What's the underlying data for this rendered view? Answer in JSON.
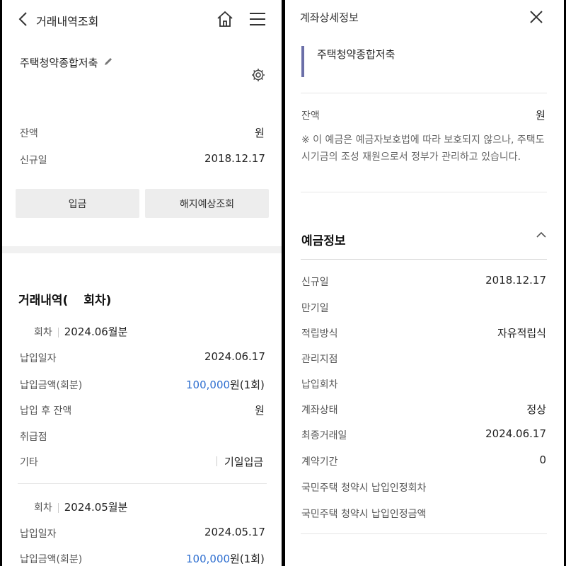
{
  "left": {
    "header": {
      "title": "거래내역조회"
    },
    "account": {
      "name": "주택청약종합저축"
    },
    "summary": {
      "balance_label": "잔액",
      "balance_unit": "원",
      "open_label": "신규일",
      "open_value": "2018.12.17"
    },
    "buttons": {
      "deposit": "입금",
      "termination": "해지예상조회"
    },
    "history": {
      "title_prefix": "거래내역(",
      "title_suffix": "회차)",
      "entries": [
        {
          "round_label": "회차",
          "round_value": "2024.06월분",
          "pay_date_label": "납입일자",
          "pay_date": "2024.06.17",
          "amount_label": "납입금액(회분)",
          "amount": "100,000",
          "amount_unit": "원(1회)",
          "after_label": "납입 후 잔액",
          "after_unit": "원",
          "branch_label": "취급점",
          "etc_label": "기타",
          "etc_value": "기일입금"
        },
        {
          "round_label": "회차",
          "round_value": "2024.05월분",
          "pay_date_label": "납입일자",
          "pay_date": "2024.05.17",
          "amount_label": "납입금액(회분)",
          "amount": "100,000",
          "amount_unit": "원(1회)"
        }
      ]
    }
  },
  "right": {
    "header": {
      "title": "계좌상세정보"
    },
    "account": {
      "name": "주택청약종합저축"
    },
    "balance_label": "잔액",
    "balance_unit": "원",
    "notice": "※ 이 예금은 예금자보호법에 따라 보호되지 않으나, 주택도시기금의 조성 재원으로서 정부가 관리하고 있습니다.",
    "section_title": "예금정보",
    "rows": [
      {
        "label": "신규일",
        "value": "2018.12.17"
      },
      {
        "label": "만기일",
        "value": ""
      },
      {
        "label": "적립방식",
        "value": "자유적립식"
      },
      {
        "label": "관리지점",
        "value": ""
      },
      {
        "label": "납입회차",
        "value": ""
      },
      {
        "label": "계좌상태",
        "value": "정상"
      },
      {
        "label": "최종거래일",
        "value": "2024.06.17"
      },
      {
        "label": "계약기간",
        "value": "0"
      },
      {
        "label": "국민주택 청약시 납입인정회차",
        "value": ""
      },
      {
        "label": "국민주택 청약시 납입인정금액",
        "value": ""
      }
    ]
  }
}
